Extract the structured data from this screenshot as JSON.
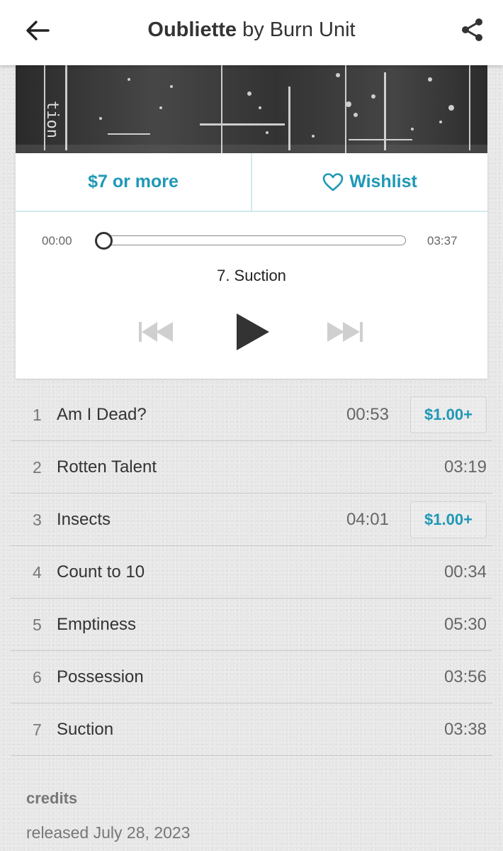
{
  "header": {
    "album_title": "Oubliette",
    "by_word": "by",
    "artist": "Burn Unit"
  },
  "buy": {
    "price_label": "$7 or more",
    "wishlist_label": "Wishlist"
  },
  "player": {
    "current_time": "00:00",
    "total_time": "03:37",
    "now_playing": "7. Suction",
    "progress_fraction": 0
  },
  "tracks": [
    {
      "num": "1",
      "title": "Am I Dead?",
      "duration": "00:53",
      "price": "$1.00+"
    },
    {
      "num": "2",
      "title": "Rotten Talent",
      "duration": "03:19"
    },
    {
      "num": "3",
      "title": "Insects",
      "duration": "04:01",
      "price": "$1.00+"
    },
    {
      "num": "4",
      "title": "Count to 10",
      "duration": "00:34"
    },
    {
      "num": "5",
      "title": "Emptiness",
      "duration": "05:30"
    },
    {
      "num": "6",
      "title": "Possession",
      "duration": "03:56"
    },
    {
      "num": "7",
      "title": "Suction",
      "duration": "03:38"
    }
  ],
  "credits": {
    "heading": "credits",
    "release_text": "released July 28, 2023"
  },
  "icons": {
    "back": "back-arrow-icon",
    "share": "share-icon",
    "wishlist": "heart-outline-icon",
    "prev": "skip-previous-icon",
    "play": "play-icon",
    "next": "skip-next-icon"
  },
  "colors": {
    "accent": "#1f98b6",
    "background": "#e7e7e7",
    "card": "#ffffff"
  }
}
